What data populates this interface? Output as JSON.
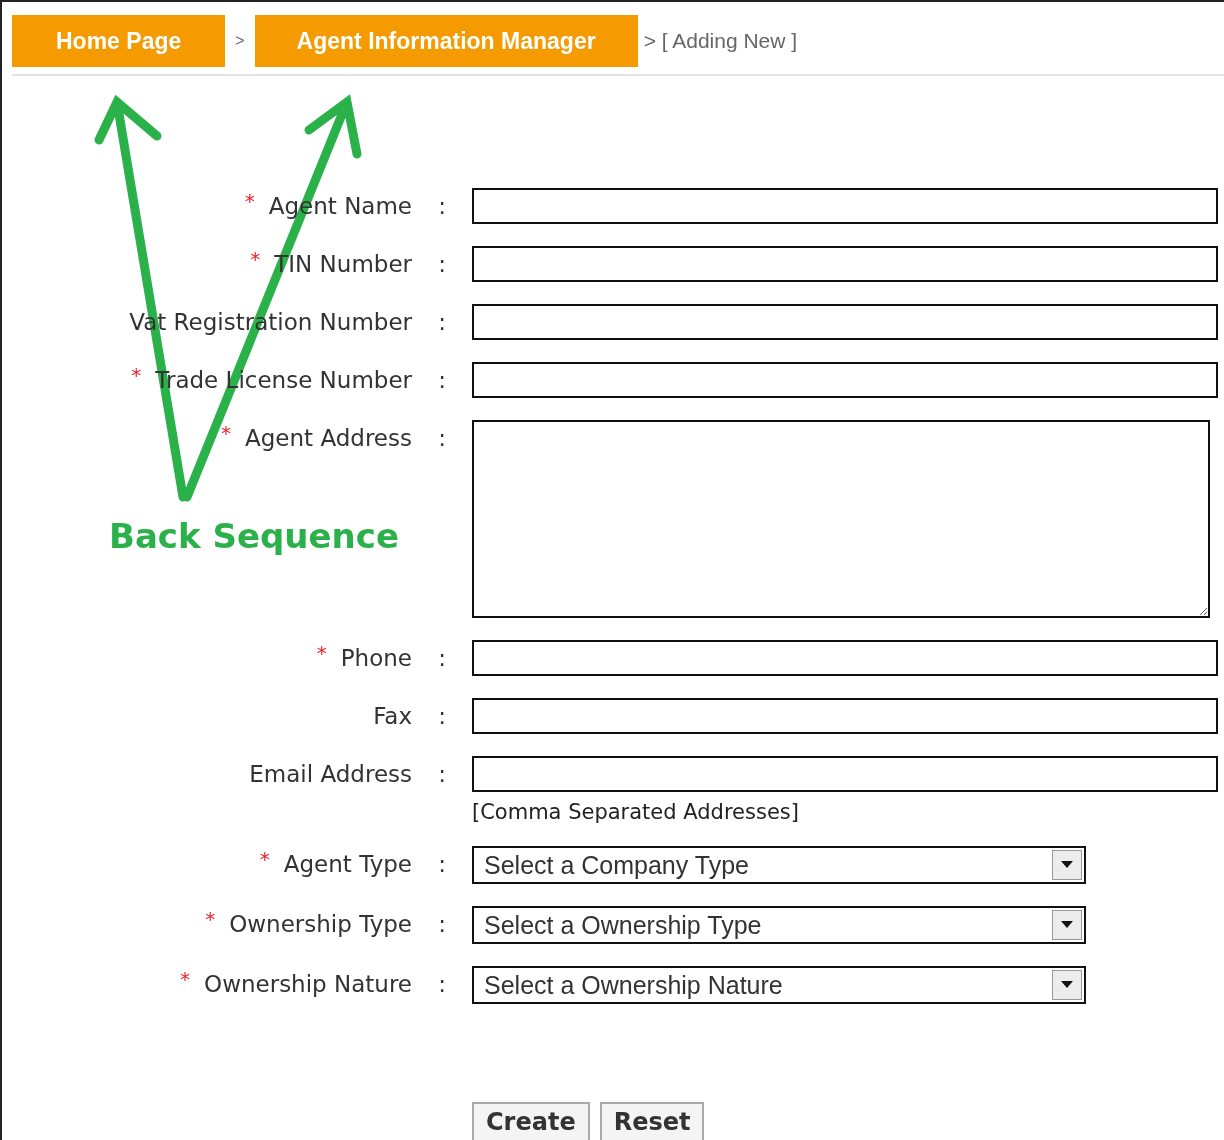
{
  "breadcrumb": {
    "items": [
      {
        "label": "Home Page"
      },
      {
        "label": "Agent Information Manager"
      }
    ],
    "separator": ">",
    "current": "> [ Adding New ]"
  },
  "form": {
    "separator": ":",
    "fields": [
      {
        "kind": "text",
        "label": "Agent Name",
        "required": true
      },
      {
        "kind": "text",
        "label": "TIN Number",
        "required": true
      },
      {
        "kind": "text",
        "label": "Vat Registration Number",
        "required": false
      },
      {
        "kind": "text",
        "label": "Trade License Number",
        "required": true
      },
      {
        "kind": "textarea",
        "label": "Agent Address",
        "required": true
      },
      {
        "kind": "text",
        "label": "Phone",
        "required": true
      },
      {
        "kind": "text",
        "label": "Fax",
        "required": false
      },
      {
        "kind": "text",
        "label": "Email Address",
        "required": false,
        "hint": "[Comma Separated Addresses]"
      },
      {
        "kind": "select",
        "label": "Agent Type",
        "required": true,
        "value": "Select a Company Type"
      },
      {
        "kind": "select",
        "label": "Ownership Type",
        "required": true,
        "value": "Select a Ownership Type"
      },
      {
        "kind": "select",
        "label": "Ownership Nature",
        "required": true,
        "value": "Select a Ownership Nature"
      }
    ],
    "required_mark": "*",
    "buttons": [
      "Create",
      "Reset"
    ]
  },
  "annotation": {
    "text": "Back Sequence"
  }
}
